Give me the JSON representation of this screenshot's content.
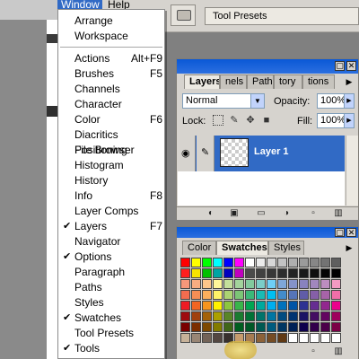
{
  "menubar": {
    "window": "Window",
    "help": "Help"
  },
  "topbar": {
    "tool_presets_tab": "Tool Presets"
  },
  "window_menu": {
    "items": [
      {
        "label": "Arrange",
        "accel": "",
        "checked": false
      },
      {
        "label": "Workspace",
        "accel": "",
        "checked": false
      },
      {
        "label": "Actions",
        "accel": "Alt+F9",
        "checked": false
      },
      {
        "label": "Brushes",
        "accel": "F5",
        "checked": false
      },
      {
        "label": "Channels",
        "accel": "",
        "checked": false
      },
      {
        "label": "Character",
        "accel": "",
        "checked": false
      },
      {
        "label": "Color",
        "accel": "F6",
        "checked": false
      },
      {
        "label": "Diacritics Positioning",
        "accel": "",
        "checked": false
      },
      {
        "label": "File Browser",
        "accel": "",
        "checked": false
      },
      {
        "label": "Histogram",
        "accel": "",
        "checked": false
      },
      {
        "label": "History",
        "accel": "",
        "checked": false
      },
      {
        "label": "Info",
        "accel": "F8",
        "checked": false
      },
      {
        "label": "Layer Comps",
        "accel": "",
        "checked": false
      },
      {
        "label": "Layers",
        "accel": "F7",
        "checked": true
      },
      {
        "label": "Navigator",
        "accel": "",
        "checked": false
      },
      {
        "label": "Options",
        "accel": "",
        "checked": true
      },
      {
        "label": "Paragraph",
        "accel": "",
        "checked": false
      },
      {
        "label": "Paths",
        "accel": "",
        "checked": false
      },
      {
        "label": "Styles",
        "accel": "",
        "checked": false
      },
      {
        "label": "Swatches",
        "accel": "",
        "checked": true
      },
      {
        "label": "Tool Presets",
        "accel": "",
        "checked": false
      },
      {
        "label": "Tools",
        "accel": "",
        "checked": true
      }
    ]
  },
  "layers_palette": {
    "tabs": [
      "Layers",
      "nels",
      "Paths",
      "tory",
      "tions"
    ],
    "blend_mode": "Normal",
    "opacity_label": "Opacity:",
    "opacity_value": "100%",
    "lock_label": "Lock:",
    "fill_label": "Fill:",
    "fill_value": "100%",
    "layer_name": "Layer 1"
  },
  "swatches_palette": {
    "tabs": [
      "Color",
      "Swatches",
      "Styles"
    ],
    "rows": [
      [
        "#ff0000",
        "#ffff00",
        "#00ff00",
        "#00ffff",
        "#0000ff",
        "#ff00ff",
        "#ffffff",
        "#ebebeb",
        "#d7d7d7",
        "#c3c3c3",
        "#afafaf",
        "#9b9b9b",
        "#878787",
        "#737373",
        "#5f5f5f"
      ],
      [
        "#ff1f1f",
        "#f7e400",
        "#00c000",
        "#00a4a4",
        "#0000c0",
        "#c000c0",
        "#4b4b4b",
        "#414141",
        "#373737",
        "#2d2d2d",
        "#232323",
        "#191919",
        "#0f0f0f",
        "#050505",
        "#000000"
      ],
      [
        "#f7977a",
        "#f9ad81",
        "#fdc68a",
        "#fff79a",
        "#c4df9b",
        "#a3d39c",
        "#82ca9d",
        "#7bcdc8",
        "#6ecff6",
        "#7ea7d8",
        "#8493ca",
        "#8882be",
        "#a187be",
        "#bc8dbf",
        "#f49ac2"
      ],
      [
        "#f26c4f",
        "#f68e55",
        "#fbaf5c",
        "#fff467",
        "#acd372",
        "#7cc576",
        "#3bb878",
        "#1abbb4",
        "#00bff3",
        "#438ccb",
        "#5574b9",
        "#605ca8",
        "#855fa8",
        "#a763a8",
        "#f06ea9"
      ],
      [
        "#ed1c24",
        "#f26522",
        "#f7941d",
        "#fff200",
        "#8dc63f",
        "#39b54a",
        "#00a651",
        "#00a99d",
        "#00aeef",
        "#0072bc",
        "#0054a6",
        "#2e3192",
        "#662d91",
        "#92278f",
        "#ec008c"
      ],
      [
        "#9e0b0f",
        "#a0410d",
        "#a36209",
        "#aba000",
        "#598527",
        "#1a7b30",
        "#007236",
        "#00746b",
        "#0076a3",
        "#004b80",
        "#003471",
        "#1b1464",
        "#440e62",
        "#630460",
        "#9e005d"
      ],
      [
        "#790000",
        "#7b2e00",
        "#7d4900",
        "#827b00",
        "#406618",
        "#005e20",
        "#005826",
        "#005952",
        "#005b7f",
        "#003663",
        "#002157",
        "#0d004c",
        "#32004b",
        "#4b0049",
        "#7b0046"
      ],
      [
        "#c7b299",
        "#998675",
        "#736357",
        "#534741",
        "#37302d",
        "#c69c6d",
        "#a67c52",
        "#8c6239",
        "#754c24",
        "#603913",
        "#ffffff",
        "#ffffff",
        "#ffffff",
        "#ffffff",
        "#ffffff"
      ]
    ]
  },
  "colors": {
    "menu_highlight": "#316ac5",
    "palette_title": "#0a58d6",
    "panel_bg": "#d6d3ce"
  }
}
